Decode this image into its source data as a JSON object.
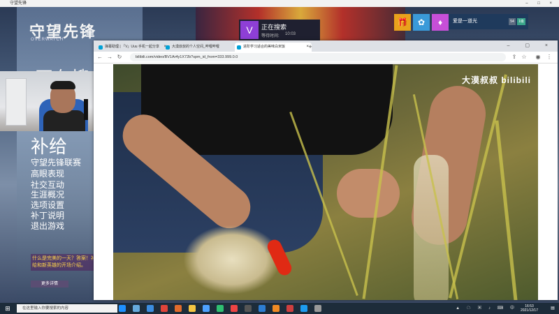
{
  "stream_window": {
    "title": "守望先锋",
    "controls": "– □ ×"
  },
  "game_menu": {
    "logo": "守望先锋",
    "logo_sub": "OVERWATCH",
    "big_text": "正在搜",
    "heading": "补给",
    "items": [
      "守望先锋联赛",
      "高眼表现",
      "社交互动",
      "生涯概况",
      "选项设置",
      "补丁说明",
      "退出游戏"
    ],
    "promo_text": "什么是完美的一天？答案！补给和新英雄的开场介绍。",
    "promo_button": "更多详情"
  },
  "matchmaking": {
    "title": "正在搜索",
    "wait_label": "等待时间:",
    "wait_value": "10:03",
    "icon": "overwatch-icon"
  },
  "top_buttons": [
    {
      "name": "lootbox-button",
      "glyph": "🎁",
      "color": "#e9a21c"
    },
    {
      "name": "social-button",
      "glyph": "✿",
      "color": "#3a9ad9"
    },
    {
      "name": "profile-button",
      "glyph": "♦",
      "color": "#c74fd8"
    }
  ],
  "party": {
    "name": "爱是一道光",
    "badge1": "54",
    "badge2": "1级"
  },
  "browser": {
    "tabs": [
      {
        "label": "弹幕助理 | 「V」Uuu 手机一起分享",
        "active": false
      },
      {
        "label": "大漠叔叔的个人空间_哔哩哔哩",
        "active": false
      },
      {
        "label": "进阶学习适合的美味白米饭",
        "active": true
      }
    ],
    "new_tab": "+",
    "window_controls": "– ▢ ×",
    "url": "bilibili.com/video/BV1Ar4y1X72b?spm_id_from=333.999.0.0",
    "watermark": "大漠叔叔 bilibili"
  },
  "taskbar": {
    "start_glyph": "⊞",
    "search_placeholder": "在这里输入你要搜索的内容",
    "apps": [
      "#1e90ff",
      "#6ad",
      "#3c8de0",
      "#e0443a",
      "#e06b2c",
      "#f5c542",
      "#4ea1ff",
      "#2fbf71",
      "#e44",
      "#555",
      "#2d7dd2",
      "#f08a24",
      "#cf3f3f",
      "#1d9bf0",
      "#999"
    ],
    "tray_icons": "▲ ☁ ▣ ♪ ⌨ 中",
    "time": "16:53",
    "date": "2021/12/17",
    "notif": "▤"
  }
}
